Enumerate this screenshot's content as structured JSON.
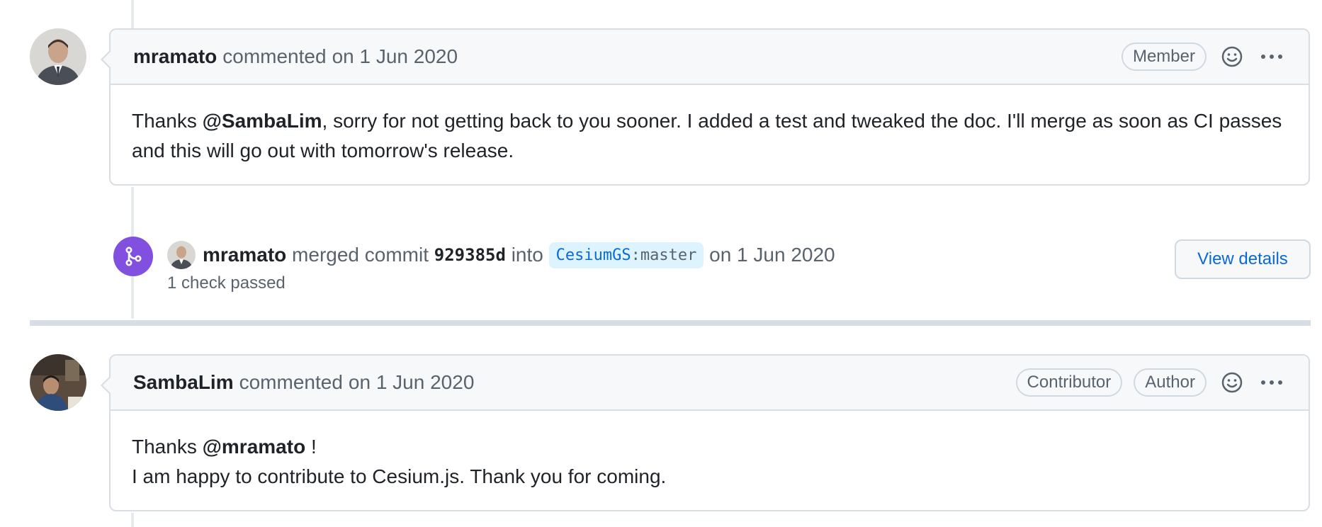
{
  "comments": [
    {
      "author": "mramato",
      "action": "commented",
      "date": "on 1 Jun 2020",
      "badges": [
        "Member"
      ],
      "body": {
        "text1": "Thanks ",
        "mention": "@SambaLim",
        "text2": ", sorry for not getting back to you sooner. I added a test and tweaked the doc. I'll merge as soon as CI passes and this will go out with tomorrow's release."
      }
    },
    {
      "author": "SambaLim",
      "action": "commented",
      "date": "on 1 Jun 2020",
      "badges": [
        "Contributor",
        "Author"
      ],
      "body": {
        "line1_prefix": "Thanks ",
        "line1_mention": "@mramato",
        "line1_suffix": " !",
        "line2": "I am happy to contribute to Cesium.js. Thank you for coming."
      }
    }
  ],
  "merge_event": {
    "user": "mramato",
    "action": "merged commit",
    "sha": "929385d",
    "into": "into",
    "repo": "CesiumGS",
    "separator": ":",
    "branch": "master",
    "date": "on 1 Jun 2020",
    "checks": "1 check passed",
    "view_details_label": "View details"
  },
  "icons": {
    "reaction": "smiley-icon",
    "more": "kebab-horizontal-icon",
    "merge": "git-merge-icon"
  },
  "colors": {
    "merge_badge": "#8250df",
    "link": "#0969da",
    "branch_bg": "#ddf4ff"
  }
}
